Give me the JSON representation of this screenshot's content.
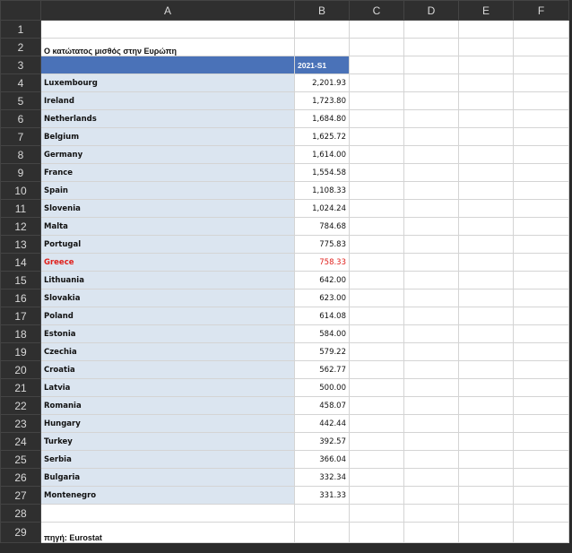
{
  "columns": [
    "A",
    "B",
    "C",
    "D",
    "E",
    "F"
  ],
  "title": "Ο κατώτατος μισθός στην Ευρώπη",
  "header": "2021-S1",
  "source": "πηγή: Eurostat",
  "highlight_color": "#e0201c",
  "header_fill": "#4a72b8",
  "name_fill": "#dbe5f0",
  "rows": [
    {
      "row": "4",
      "country": "Luxembourg",
      "value": "2,201.93"
    },
    {
      "row": "5",
      "country": "Ireland",
      "value": "1,723.80"
    },
    {
      "row": "6",
      "country": "Netherlands",
      "value": "1,684.80"
    },
    {
      "row": "7",
      "country": "Belgium",
      "value": "1,625.72"
    },
    {
      "row": "8",
      "country": "Germany",
      "value": "1,614.00"
    },
    {
      "row": "9",
      "country": "France",
      "value": "1,554.58"
    },
    {
      "row": "10",
      "country": "Spain",
      "value": "1,108.33"
    },
    {
      "row": "11",
      "country": "Slovenia",
      "value": "1,024.24"
    },
    {
      "row": "12",
      "country": "Malta",
      "value": "784.68"
    },
    {
      "row": "13",
      "country": "Portugal",
      "value": "775.83"
    },
    {
      "row": "14",
      "country": "Greece",
      "value": "758.33",
      "highlight": true
    },
    {
      "row": "15",
      "country": "Lithuania",
      "value": "642.00"
    },
    {
      "row": "16",
      "country": "Slovakia",
      "value": "623.00"
    },
    {
      "row": "17",
      "country": "Poland",
      "value": "614.08"
    },
    {
      "row": "18",
      "country": "Estonia",
      "value": "584.00"
    },
    {
      "row": "19",
      "country": "Czechia",
      "value": "579.22"
    },
    {
      "row": "20",
      "country": "Croatia",
      "value": "562.77"
    },
    {
      "row": "21",
      "country": "Latvia",
      "value": "500.00"
    },
    {
      "row": "22",
      "country": "Romania",
      "value": "458.07"
    },
    {
      "row": "23",
      "country": "Hungary",
      "value": "442.44"
    },
    {
      "row": "24",
      "country": "Turkey",
      "value": "392.57"
    },
    {
      "row": "25",
      "country": "Serbia",
      "value": "366.04"
    },
    {
      "row": "26",
      "country": "Bulgaria",
      "value": "332.34"
    },
    {
      "row": "27",
      "country": "Montenegro",
      "value": "331.33"
    }
  ],
  "row_numbers": {
    "r1": "1",
    "r2": "2",
    "r3": "3",
    "r28": "28",
    "r29": "29"
  }
}
